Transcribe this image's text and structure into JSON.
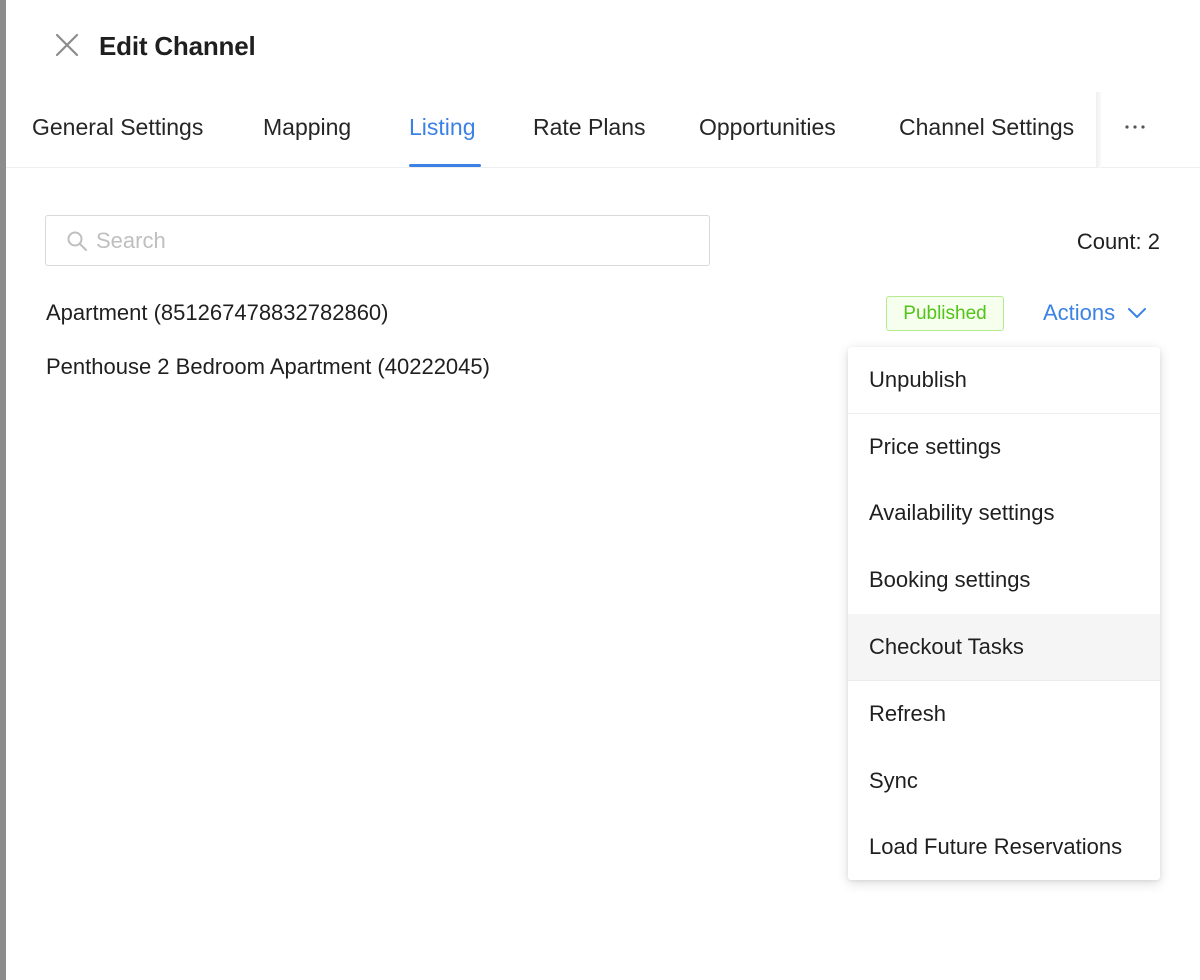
{
  "header": {
    "title": "Edit Channel",
    "close_icon": "close-icon"
  },
  "tabs": [
    {
      "label": "General Settings"
    },
    {
      "label": "Mapping"
    },
    {
      "label": "Listing"
    },
    {
      "label": "Rate Plans"
    },
    {
      "label": "Opportunities"
    },
    {
      "label": "Channel Settings"
    }
  ],
  "tabs_more_icon": "ellipsis-icon",
  "active_tab": "Listing",
  "search": {
    "placeholder": "Search",
    "value": ""
  },
  "count_label": "Count: 2",
  "listings": [
    {
      "name": "Apartment (851267478832782860)",
      "status": "Published",
      "actions_label": "Actions"
    },
    {
      "name": "Penthouse 2 Bedroom Apartment (40222045)"
    }
  ],
  "actions_menu": {
    "items": [
      {
        "label": "Unpublish"
      },
      {
        "label": "Price settings"
      },
      {
        "label": "Availability settings"
      },
      {
        "label": "Booking settings"
      },
      {
        "label": "Checkout Tasks"
      },
      {
        "label": "Refresh"
      },
      {
        "label": "Sync"
      },
      {
        "label": "Load Future Reservations"
      }
    ],
    "highlighted": "Checkout Tasks"
  },
  "colors": {
    "accent": "#3b82e6",
    "success_text": "#52c41a",
    "success_bg": "#f6ffed",
    "success_border": "#b7eb8f"
  }
}
